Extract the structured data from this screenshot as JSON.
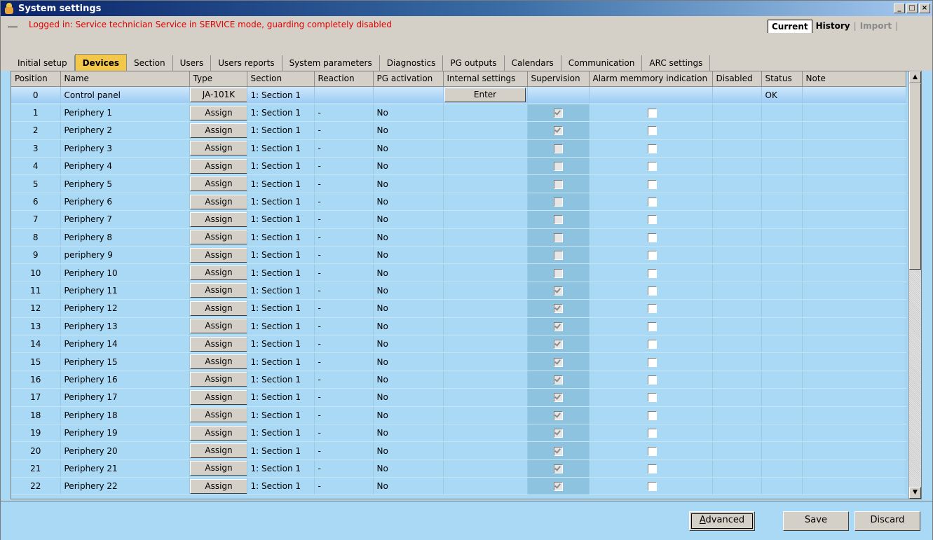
{
  "window": {
    "title": "System settings",
    "controls": [
      "_",
      "□",
      "×"
    ]
  },
  "info": {
    "dash": "",
    "message": "Logged in: Service technician Service in SERVICE mode, guarding completely disabled"
  },
  "history_tabs": {
    "current": "Current",
    "history": "History",
    "import": "Import"
  },
  "tabs": [
    "Initial setup",
    "Devices",
    "Section",
    "Users",
    "Users reports",
    "System parameters",
    "Diagnostics",
    "PG outputs",
    "Calendars",
    "Communication",
    "ARC settings"
  ],
  "active_tab": "Devices",
  "columns": [
    "Position",
    "Name",
    "Type",
    "Section",
    "Reaction",
    "PG activation",
    "Internal settings",
    "Supervision",
    "Alarm memmory indication",
    "Disabled",
    "Status",
    "Note"
  ],
  "rows": [
    {
      "pos": "0",
      "name": "Control panel",
      "type": "JA-101K",
      "section": "1: Section 1",
      "reaction": "",
      "pg": "",
      "internal": "Enter",
      "supervision": null,
      "alarm": null,
      "status": "OK"
    },
    {
      "pos": "1",
      "name": "Periphery 1",
      "type": "Assign",
      "section": "1: Section 1",
      "reaction": "-",
      "pg": "No",
      "internal": "",
      "supervision": true,
      "alarm": false,
      "status": ""
    },
    {
      "pos": "2",
      "name": "Periphery 2",
      "type": "Assign",
      "section": "1: Section 1",
      "reaction": "-",
      "pg": "No",
      "internal": "",
      "supervision": true,
      "alarm": false,
      "status": ""
    },
    {
      "pos": "3",
      "name": "Periphery 3",
      "type": "Assign",
      "section": "1: Section 1",
      "reaction": "-",
      "pg": "No",
      "internal": "",
      "supervision": false,
      "alarm": false,
      "status": ""
    },
    {
      "pos": "4",
      "name": "Periphery 4",
      "type": "Assign",
      "section": "1: Section 1",
      "reaction": "-",
      "pg": "No",
      "internal": "",
      "supervision": false,
      "alarm": false,
      "status": ""
    },
    {
      "pos": "5",
      "name": "Periphery 5",
      "type": "Assign",
      "section": "1: Section 1",
      "reaction": "-",
      "pg": "No",
      "internal": "",
      "supervision": false,
      "alarm": false,
      "status": ""
    },
    {
      "pos": "6",
      "name": "Periphery 6",
      "type": "Assign",
      "section": "1: Section 1",
      "reaction": "-",
      "pg": "No",
      "internal": "",
      "supervision": false,
      "alarm": false,
      "status": ""
    },
    {
      "pos": "7",
      "name": "Periphery 7",
      "type": "Assign",
      "section": "1: Section 1",
      "reaction": "-",
      "pg": "No",
      "internal": "",
      "supervision": false,
      "alarm": false,
      "status": ""
    },
    {
      "pos": "8",
      "name": "Periphery 8",
      "type": "Assign",
      "section": "1: Section 1",
      "reaction": "-",
      "pg": "No",
      "internal": "",
      "supervision": false,
      "alarm": false,
      "status": ""
    },
    {
      "pos": "9",
      "name": "periphery 9",
      "type": "Assign",
      "section": "1: Section 1",
      "reaction": "-",
      "pg": "No",
      "internal": "",
      "supervision": false,
      "alarm": false,
      "status": ""
    },
    {
      "pos": "10",
      "name": "Periphery 10",
      "type": "Assign",
      "section": "1: Section 1",
      "reaction": "-",
      "pg": "No",
      "internal": "",
      "supervision": false,
      "alarm": false,
      "status": ""
    },
    {
      "pos": "11",
      "name": "Periphery 11",
      "type": "Assign",
      "section": "1: Section 1",
      "reaction": "-",
      "pg": "No",
      "internal": "",
      "supervision": true,
      "alarm": false,
      "status": ""
    },
    {
      "pos": "12",
      "name": "Periphery 12",
      "type": "Assign",
      "section": "1: Section 1",
      "reaction": "-",
      "pg": "No",
      "internal": "",
      "supervision": true,
      "alarm": false,
      "status": ""
    },
    {
      "pos": "13",
      "name": "Periphery 13",
      "type": "Assign",
      "section": "1: Section 1",
      "reaction": "-",
      "pg": "No",
      "internal": "",
      "supervision": true,
      "alarm": false,
      "status": ""
    },
    {
      "pos": "14",
      "name": "Periphery 14",
      "type": "Assign",
      "section": "1: Section 1",
      "reaction": "-",
      "pg": "No",
      "internal": "",
      "supervision": true,
      "alarm": false,
      "status": ""
    },
    {
      "pos": "15",
      "name": "Periphery 15",
      "type": "Assign",
      "section": "1: Section 1",
      "reaction": "-",
      "pg": "No",
      "internal": "",
      "supervision": true,
      "alarm": false,
      "status": ""
    },
    {
      "pos": "16",
      "name": "Periphery 16",
      "type": "Assign",
      "section": "1: Section 1",
      "reaction": "-",
      "pg": "No",
      "internal": "",
      "supervision": true,
      "alarm": false,
      "status": ""
    },
    {
      "pos": "17",
      "name": "Periphery 17",
      "type": "Assign",
      "section": "1: Section 1",
      "reaction": "-",
      "pg": "No",
      "internal": "",
      "supervision": true,
      "alarm": false,
      "status": ""
    },
    {
      "pos": "18",
      "name": "Periphery 18",
      "type": "Assign",
      "section": "1: Section 1",
      "reaction": "-",
      "pg": "No",
      "internal": "",
      "supervision": true,
      "alarm": false,
      "status": ""
    },
    {
      "pos": "19",
      "name": "Periphery 19",
      "type": "Assign",
      "section": "1: Section 1",
      "reaction": "-",
      "pg": "No",
      "internal": "",
      "supervision": true,
      "alarm": false,
      "status": ""
    },
    {
      "pos": "20",
      "name": "Periphery 20",
      "type": "Assign",
      "section": "1: Section 1",
      "reaction": "-",
      "pg": "No",
      "internal": "",
      "supervision": true,
      "alarm": false,
      "status": ""
    },
    {
      "pos": "21",
      "name": "Periphery 21",
      "type": "Assign",
      "section": "1: Section 1",
      "reaction": "-",
      "pg": "No",
      "internal": "",
      "supervision": true,
      "alarm": false,
      "status": ""
    },
    {
      "pos": "22",
      "name": "Periphery 22",
      "type": "Assign",
      "section": "1: Section 1",
      "reaction": "-",
      "pg": "No",
      "internal": "",
      "supervision": true,
      "alarm": false,
      "status": ""
    }
  ],
  "buttons": {
    "advanced": "Advanced",
    "save": "Save",
    "discard": "Discard"
  },
  "colors": {
    "title_start": "#0a246a",
    "grid_bg": "#a9d9f5",
    "active_tab": "#f3c84a",
    "warning_text": "#e30000"
  }
}
